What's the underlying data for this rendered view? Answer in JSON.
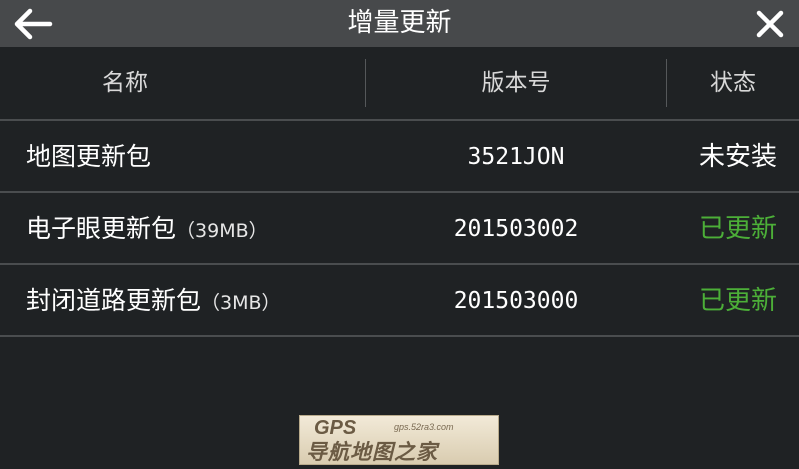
{
  "titlebar": {
    "title": "增量更新",
    "back_icon": "arrow-left-icon",
    "close_icon": "close-icon"
  },
  "table": {
    "columns": [
      "名称",
      "版本号",
      "状态"
    ],
    "rows": [
      {
        "name": "地图更新包",
        "size": "",
        "version": "3521JON",
        "status": "未安装",
        "status_color": "#ffffff"
      },
      {
        "name": "电子眼更新包",
        "size": "（39MB）",
        "version": "201503002",
        "status": "已更新",
        "status_color": "#4caf38"
      },
      {
        "name": "封闭道路更新包",
        "size": "（3MB）",
        "version": "201503000",
        "status": "已更新",
        "status_color": "#4caf38"
      }
    ]
  },
  "watermark": {
    "brand": "GPS",
    "url": "gps.52ra3.com",
    "text": "导航地图之家"
  },
  "colors": {
    "background": "#1f2224",
    "titlebar": "#47494b",
    "updated": "#4caf38"
  }
}
